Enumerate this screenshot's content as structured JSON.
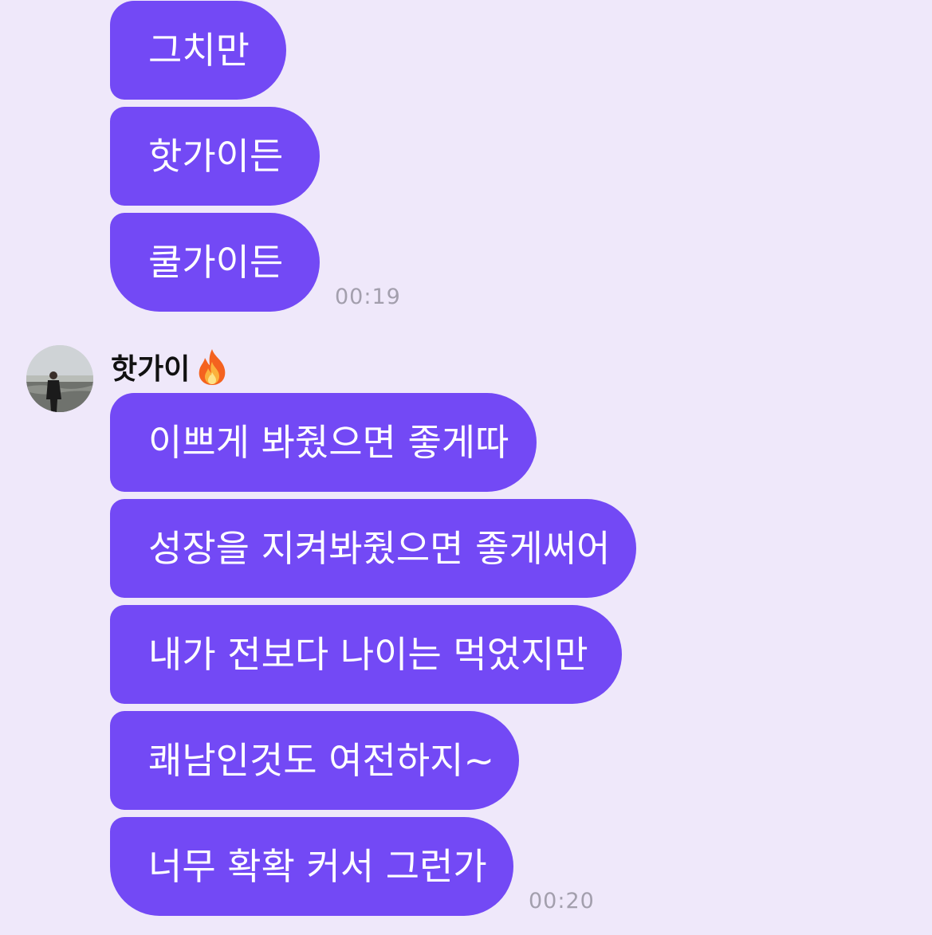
{
  "conversation": {
    "group1": {
      "messages": [
        "그치만",
        "핫가이든",
        "쿨가이든"
      ],
      "time": "00:19"
    },
    "group2": {
      "sender": {
        "name": "핫가이",
        "emoji_icon": "fire-icon",
        "avatar_icon": "profile-photo-beach-icon"
      },
      "messages": [
        "이쁘게 봐줬으면 좋게따",
        "성장을 지켜봐줬으면 좋게써어",
        "내가 전보다 나이는 먹었지만",
        "쾌남인것도 여전하지~",
        "너무 확확 커서 그런가"
      ],
      "time": "00:20"
    }
  },
  "colors": {
    "background": "#efe8fa",
    "bubble": "#7349f5",
    "bubble_text": "#ffffff",
    "timestamp": "#a39fad"
  }
}
